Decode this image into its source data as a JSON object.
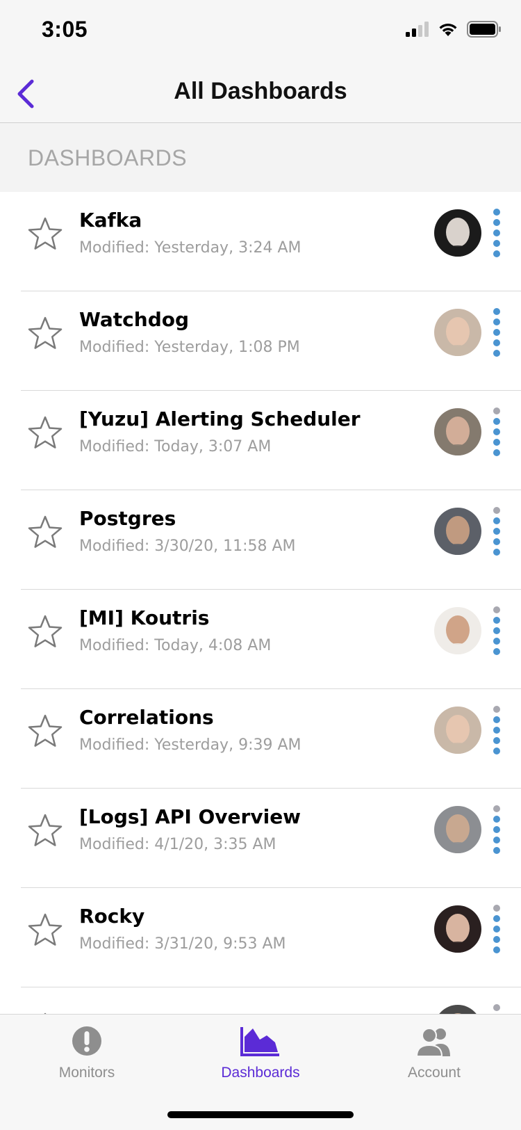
{
  "status": {
    "time": "3:05"
  },
  "nav": {
    "title": "All Dashboards"
  },
  "section": {
    "title": "DASHBOARDS"
  },
  "dashboards": [
    {
      "title": "Kafka",
      "modified": "Modified: Yesterday, 3:24 AM",
      "avatar_colors": [
        "#1b1b1b",
        "#d9d2cc"
      ]
    },
    {
      "title": "Watchdog",
      "modified": "Modified: Yesterday, 1:08 PM",
      "avatar_colors": [
        "#c9b8a8",
        "#e6c6b0"
      ]
    },
    {
      "title": "[Yuzu] Alerting Scheduler",
      "modified": "Modified: Today, 3:07 AM",
      "avatar_colors": [
        "#847a6e",
        "#d2ad98"
      ]
    },
    {
      "title": "Postgres",
      "modified": "Modified: 3/30/20, 11:58 AM",
      "avatar_colors": [
        "#5c6068",
        "#c09a80"
      ]
    },
    {
      "title": "[MI] Koutris",
      "modified": "Modified: Today, 4:08 AM",
      "avatar_colors": [
        "#efece8",
        "#d0a488"
      ]
    },
    {
      "title": "Correlations",
      "modified": "Modified: Yesterday, 9:39 AM",
      "avatar_colors": [
        "#c9b8a8",
        "#e6c6b0"
      ]
    },
    {
      "title": "[Logs] API Overview",
      "modified": "Modified: 4/1/20, 3:35 AM",
      "avatar_colors": [
        "#8c8e92",
        "#c8a890"
      ]
    },
    {
      "title": "Rocky",
      "modified": "Modified: 3/31/20, 9:53 AM",
      "avatar_colors": [
        "#2a2020",
        "#d8b4a0"
      ]
    },
    {
      "title": "",
      "modified": "",
      "avatar_colors": [
        "#4a4a4a",
        "#c8a890"
      ]
    }
  ],
  "tabs": [
    {
      "label": "Monitors",
      "icon": "exclamation-icon",
      "active": false
    },
    {
      "label": "Dashboards",
      "icon": "area-chart-icon",
      "active": true
    },
    {
      "label": "Account",
      "icon": "users-icon",
      "active": false
    }
  ],
  "colors": {
    "accent": "#5b2bd6",
    "kebab_blue": "#4a94d1",
    "subtitle_grey": "#9d9d9d"
  }
}
